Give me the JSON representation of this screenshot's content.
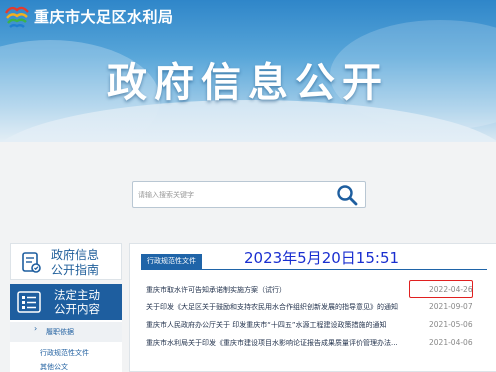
{
  "header": {
    "site_title": "重庆市大足区水利局",
    "hero_title": "政府信息公开"
  },
  "search": {
    "placeholder": "请输入搜索关键字",
    "icon": "search-icon"
  },
  "sidebar": {
    "guide": {
      "label_line1": "政府信息",
      "label_line2": "公开指南",
      "icon": "guide-icon"
    },
    "active": {
      "label_line1": "法定主动",
      "label_line2": "公开内容",
      "icon": "list-icon"
    },
    "category": {
      "bullet": "›",
      "label": "履职依据"
    },
    "items": [
      "行政规范性文件",
      "其他公文"
    ]
  },
  "main": {
    "tab_label": "行政规范性文件",
    "overlay_timestamp": "2023年5月20日15:51",
    "rows": [
      {
        "title": "重庆市取水许可告知承诺制实施方案（试行）",
        "date": "2022-04-26"
      },
      {
        "title": "关于印发《大足区关于鼓励和支持农民用水合作组织创新发展的指导意见》的通知",
        "date": "2021-09-07"
      },
      {
        "title": "重庆市人民政府办公厅关于 印发重庆市“十四五”水源工程建设政策措施的通知",
        "date": "2021-05-06"
      },
      {
        "title": "重庆市水利局关于印发《重庆市建设项目水影响论证报告成果质量评价管理办法...",
        "date": "2021-04-06"
      }
    ]
  },
  "colors": {
    "primary": "#1e5e9f",
    "highlight": "#e02020",
    "timestamp": "#1a2fd0"
  }
}
